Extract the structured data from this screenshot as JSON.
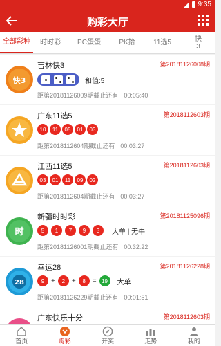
{
  "status_bar": {
    "time": "9:35"
  },
  "header": {
    "title": "购彩大厅"
  },
  "tabs": [
    {
      "label": "全部彩种"
    },
    {
      "label": "时时彩"
    },
    {
      "label": "PC蛋蛋"
    },
    {
      "label": "PK拾"
    },
    {
      "label": "11选5"
    },
    {
      "label": "快3"
    }
  ],
  "lotteries": [
    {
      "name": "吉林快3",
      "issue": "第20181126008期",
      "extra": "和值:5",
      "deadline_text": "距第20181126009期截止还有",
      "deadline_time": "00:05:40",
      "logo_color": "#ef7f1a",
      "logo_label": "快3",
      "dice": [
        1,
        2,
        2
      ]
    },
    {
      "name": "广东11选5",
      "issue": "第2018112603期",
      "balls": [
        "10",
        "11",
        "05",
        "01",
        "03"
      ],
      "deadline_text": "距第2018112604期截止还有",
      "deadline_time": "00:03:27",
      "logo_color": "#f5a623"
    },
    {
      "name": "江西11选5",
      "issue": "第2018112603期",
      "balls": [
        "03",
        "01",
        "11",
        "09",
        "02"
      ],
      "deadline_text": "距第2018112604期截止还有",
      "deadline_time": "00:03:27",
      "logo_color": "#f5a623"
    },
    {
      "name": "新疆时时彩",
      "issue": "第20181125096期",
      "balls": [
        "5",
        "1",
        "7",
        "9",
        "3"
      ],
      "extra": "大单 | 无牛",
      "deadline_text": "距第20181126001期截止还有",
      "deadline_time": "00:32:22",
      "logo_color": "#3fb34f",
      "logo_label": "时"
    },
    {
      "name": "幸运28",
      "issue": "第20181126228期",
      "sum_balls": [
        "9",
        "2",
        "8"
      ],
      "sum_result": "19",
      "extra": "大单",
      "deadline_text": "距第20181126229期截止还有",
      "deadline_time": "00:01:51",
      "logo_color": "#1e9ad6",
      "logo_label": "28"
    },
    {
      "name": "广东快乐十分",
      "issue": "第2018112603期",
      "logo_color": "#e94f88"
    }
  ],
  "bottom_nav": [
    {
      "label": "首页"
    },
    {
      "label": "购彩"
    },
    {
      "label": "开奖"
    },
    {
      "label": "走势"
    },
    {
      "label": "我的"
    }
  ],
  "colors": {
    "brand_red": "#d9251d",
    "ball_red": "#e8281f",
    "ball_green": "#23a93a",
    "dice_blue": "#4c5ec6"
  }
}
